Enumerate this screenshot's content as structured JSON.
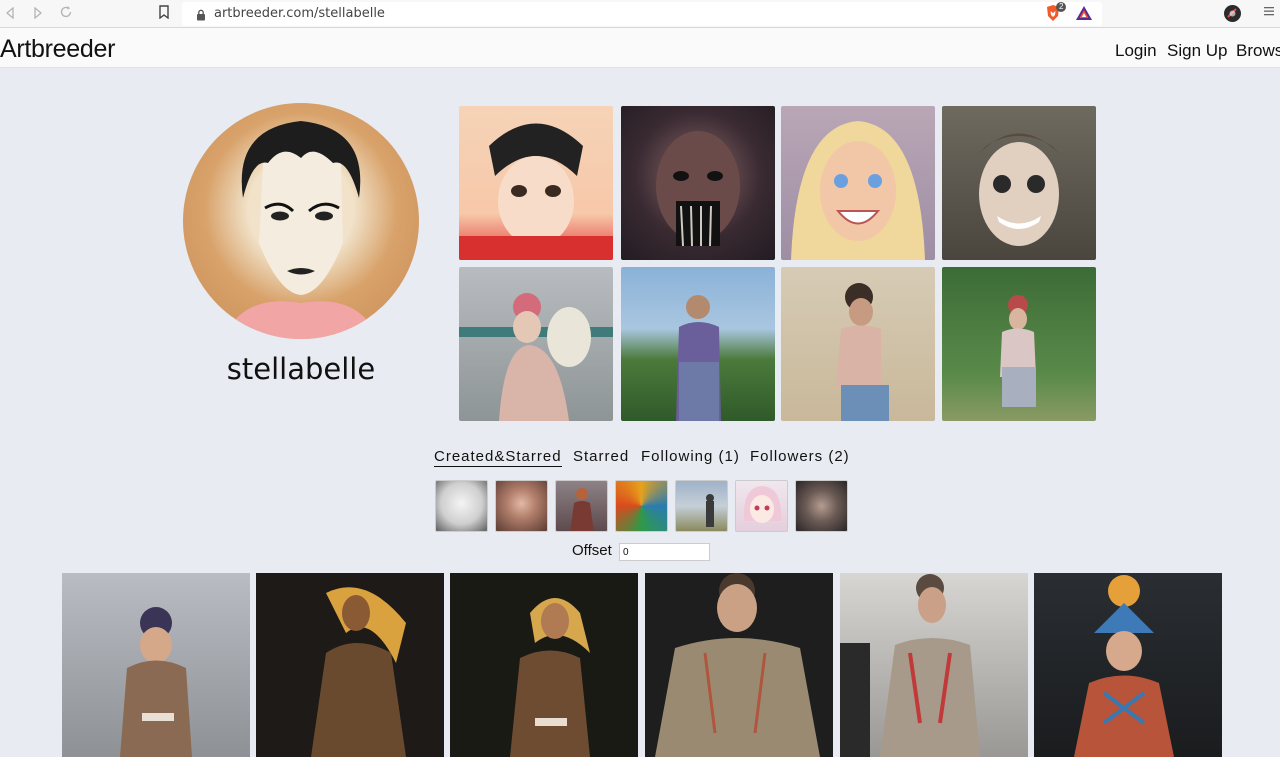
{
  "browser": {
    "url": "artbreeder.com/stellabelle",
    "brave_badge": "2"
  },
  "header": {
    "logo": "Artbreeder",
    "login": "Login",
    "signup": "Sign Up",
    "browse": "Brows"
  },
  "profile": {
    "username": "stellabelle"
  },
  "tabs": [
    {
      "label": "Created&Starred",
      "active": true
    },
    {
      "label": "Starred",
      "active": false
    },
    {
      "label": "Following (1)",
      "active": false
    },
    {
      "label": "Followers (2)",
      "active": false
    }
  ],
  "offset": {
    "label": "Offset",
    "value": "0"
  },
  "colors": {
    "page_bg": "#e9ebf2",
    "header_bg": "#fafafa",
    "brave_orange": "#f25a29",
    "bat_purple": "#5d2a8f"
  },
  "icons": {
    "back": "back-arrow-icon",
    "forward": "forward-arrow-icon",
    "reload": "reload-icon",
    "bookmark": "bookmark-icon",
    "lock": "lock-icon",
    "brave": "brave-shield-icon",
    "rewards": "bat-rewards-icon",
    "extension": "extension-icon",
    "menu": "hamburger-menu-icon"
  }
}
